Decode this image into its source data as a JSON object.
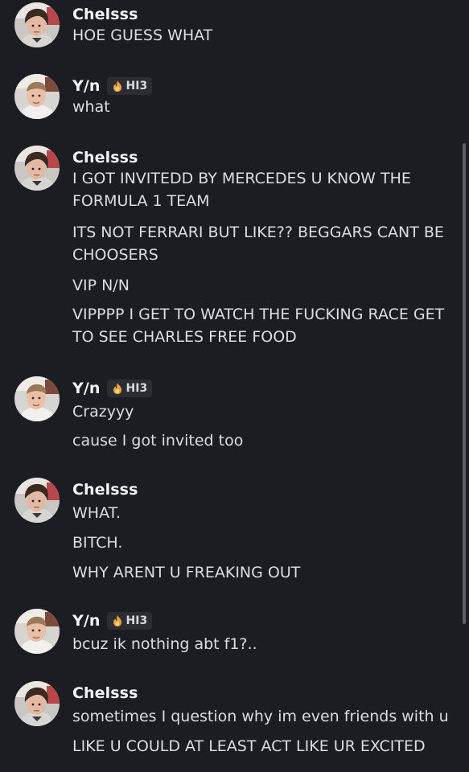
{
  "users": {
    "chelsss": {
      "name": "Chelsss"
    },
    "yn": {
      "name": "Y/n",
      "tag": {
        "icon": "fire-icon",
        "label": "HI3",
        "accent": "#f0a33a"
      }
    }
  },
  "groups": [
    {
      "author": "Chelsss",
      "messages": [
        "HOE GUESS WHAT"
      ]
    },
    {
      "author": "Y/n",
      "tag": "HI3",
      "messages": [
        "what"
      ]
    },
    {
      "author": "Chelsss",
      "messages": [
        "I GOT INVITEDD BY MERCEDES U KNOW THE FORMULA 1 TEAM",
        "ITS NOT FERRARI BUT LIKE?? BEGGARS CANT BE CHOOSERS",
        "VIP N/N",
        "VIPPPP I GET TO WATCH THE FUCKING RACE GET TO SEE CHARLES FREE FOOD"
      ]
    },
    {
      "author": "Y/n",
      "tag": "HI3",
      "messages": [
        "Crazyyy",
        "cause I got invited too"
      ]
    },
    {
      "author": "Chelsss",
      "messages": [
        "WHAT.",
        "BITCH.",
        "WHY ARENT U FREAKING OUT"
      ]
    },
    {
      "author": "Y/n",
      "tag": "HI3",
      "messages": [
        "bcuz ik nothing abt f1?.."
      ]
    },
    {
      "author": "Chelsss",
      "messages": [
        "sometimes I question why im even friends with u",
        "LIKE U COULD AT LEAST ACT LIKE UR EXCITED"
      ]
    }
  ]
}
